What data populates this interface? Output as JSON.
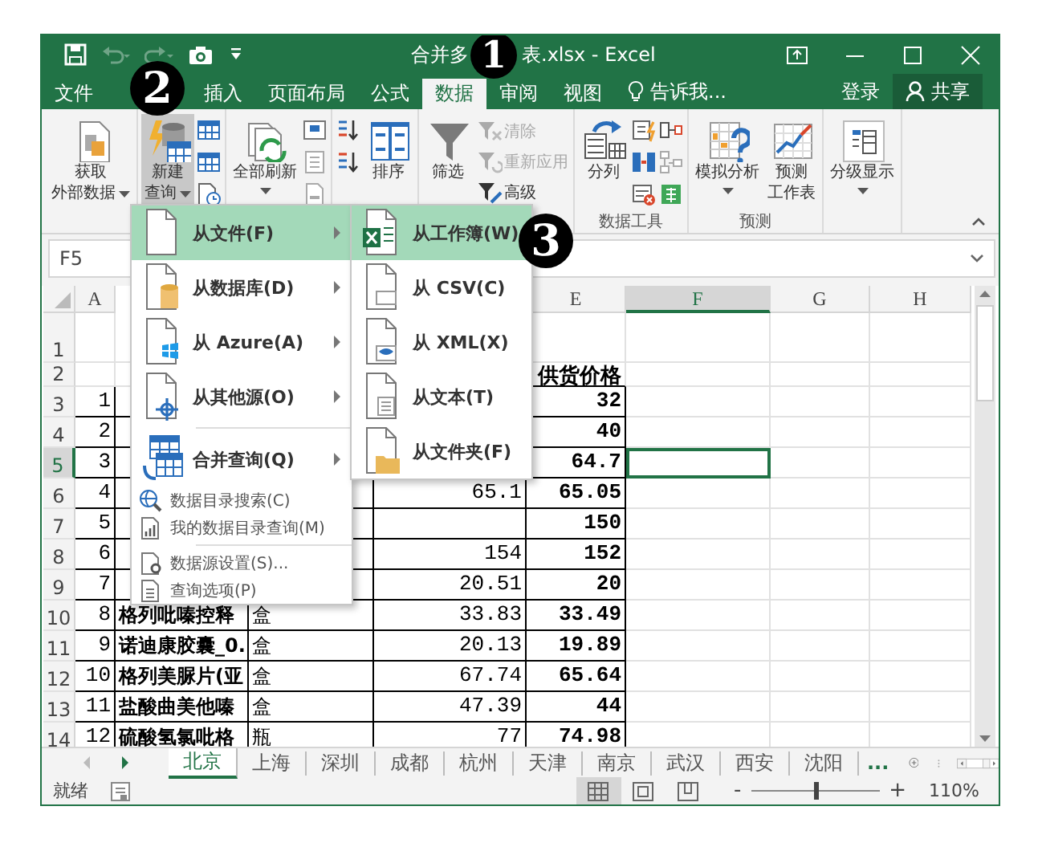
{
  "window": {
    "title_left": "合并多",
    "title_right": "表.xlsx - Excel"
  },
  "menu_tabs": [
    {
      "label": "文件",
      "selected": false
    },
    {
      "label": "插入",
      "selected": false
    },
    {
      "label": "页面布局",
      "selected": false
    },
    {
      "label": "公式",
      "selected": false
    },
    {
      "label": "数据",
      "selected": true
    },
    {
      "label": "审阅",
      "selected": false
    },
    {
      "label": "视图",
      "selected": false
    }
  ],
  "tell_me": "告诉我...",
  "account": {
    "sign_in": "登录",
    "share": "共享"
  },
  "ribbon": {
    "groups": [
      {
        "items": [
          {
            "kind": "large",
            "lines": [
              "获取",
              "外部数据"
            ],
            "dropdown": true,
            "pressed": false
          }
        ]
      },
      {
        "items": [
          {
            "kind": "large",
            "lines": [
              "新建",
              "查询"
            ],
            "dropdown": true,
            "pressed": true
          },
          {
            "kind": "icon-stack"
          }
        ]
      },
      {
        "items": [
          {
            "kind": "large",
            "lines": [
              "全部刷新"
            ],
            "dropdown": true,
            "pressed": false
          },
          {
            "kind": "icon-stack"
          }
        ]
      },
      {
        "items": [
          {
            "kind": "icon-stack"
          },
          {
            "kind": "large",
            "lines": [
              "排序"
            ],
            "dropdown": false,
            "pressed": false
          }
        ]
      },
      {
        "items": [
          {
            "kind": "large",
            "lines": [
              "筛选"
            ],
            "dropdown": false,
            "pressed": false
          },
          {
            "kind": "small-stack",
            "buttons": [
              {
                "label": "清除",
                "disabled": true
              },
              {
                "label": "重新应用",
                "disabled": true
              },
              {
                "label": "高级",
                "disabled": false
              }
            ]
          }
        ]
      },
      {
        "label": "数据工具",
        "items": [
          {
            "kind": "large",
            "lines": [
              "分列"
            ],
            "dropdown": false,
            "pressed": false
          },
          {
            "kind": "icon-stack"
          },
          {
            "kind": "icon-stack"
          }
        ]
      },
      {
        "label": "预测",
        "items": [
          {
            "kind": "large",
            "lines": [
              "模拟分析"
            ],
            "dropdown": true,
            "pressed": false
          },
          {
            "kind": "large",
            "lines": [
              "预测",
              "工作表"
            ],
            "dropdown": false,
            "pressed": false
          }
        ]
      },
      {
        "items": [
          {
            "kind": "large",
            "lines": [
              "分级显示"
            ],
            "dropdown": true,
            "pressed": false
          }
        ]
      }
    ]
  },
  "formula_bar": {
    "name_box": "F5"
  },
  "sheet": {
    "columns": [
      {
        "label": "A",
        "selected": false
      },
      {
        "kind": "covered"
      },
      {
        "kind": "covered"
      },
      {
        "kind": "covered"
      },
      {
        "label": "E",
        "selected": false
      },
      {
        "label": "F",
        "selected": true
      },
      {
        "label": "G",
        "selected": false
      },
      {
        "label": "H",
        "selected": false
      }
    ],
    "rows": [
      {
        "header": "1",
        "selected": false,
        "boxed": false
      },
      {
        "header": "2",
        "selected": false,
        "boxed": false,
        "cells": {
          "e": "供货价格"
        }
      },
      {
        "header": "3",
        "selected": false,
        "boxed": true,
        "cells": {
          "a": "1",
          "e": "32"
        }
      },
      {
        "header": "4",
        "selected": false,
        "boxed": true,
        "cells": {
          "a": "2",
          "e": "40"
        }
      },
      {
        "header": "5",
        "selected": true,
        "boxed": true,
        "cells": {
          "a": "3",
          "e": "64.7"
        }
      },
      {
        "header": "6",
        "selected": false,
        "boxed": true,
        "cells": {
          "a": "4",
          "d": "65.1",
          "e": "65.05"
        }
      },
      {
        "header": "7",
        "selected": false,
        "boxed": true,
        "cells": {
          "a": "5",
          "e": "150"
        }
      },
      {
        "header": "8",
        "selected": false,
        "boxed": true,
        "cells": {
          "a": "6",
          "d": "154",
          "e": "152"
        }
      },
      {
        "header": "9",
        "selected": false,
        "boxed": true,
        "cells": {
          "a": "7",
          "d": "20.51",
          "e": "20"
        }
      },
      {
        "header": "10",
        "selected": false,
        "boxed": true,
        "cells": {
          "a": "8",
          "b": "格列吡嗪控释",
          "c": "盒",
          "d": "33.83",
          "e": "33.49"
        }
      },
      {
        "header": "11",
        "selected": false,
        "boxed": true,
        "cells": {
          "a": "9",
          "b": "诺迪康胶囊_0.",
          "c": "盒",
          "d": "20.13",
          "e": "19.89"
        }
      },
      {
        "header": "12",
        "selected": false,
        "boxed": true,
        "cells": {
          "a": "10",
          "b": "格列美脲片(亚",
          "c": "盒",
          "d": "67.74",
          "e": "65.64"
        }
      },
      {
        "header": "13",
        "selected": false,
        "boxed": true,
        "cells": {
          "a": "11",
          "b": "盐酸曲美他嗪",
          "c": "盒",
          "d": "47.39",
          "e": "44"
        }
      },
      {
        "header": "14",
        "selected": false,
        "boxed": true,
        "cells": {
          "a": "12",
          "b": "硫酸氢氯吡格",
          "c": "瓶",
          "d": "77",
          "e": "74.98"
        }
      }
    ]
  },
  "sheet_tabs": {
    "tabs": [
      {
        "label": "北京",
        "selected": true
      },
      {
        "label": "上海",
        "selected": false
      },
      {
        "label": "深圳",
        "selected": false
      },
      {
        "label": "成都",
        "selected": false
      },
      {
        "label": "杭州",
        "selected": false
      },
      {
        "label": "天津",
        "selected": false
      },
      {
        "label": "南京",
        "selected": false
      },
      {
        "label": "武汉",
        "selected": false
      },
      {
        "label": "西安",
        "selected": false
      },
      {
        "label": "沈阳",
        "selected": false
      }
    ],
    "more": "..."
  },
  "status_bar": {
    "text": "就绪",
    "views": [
      {
        "selected": true
      },
      {
        "selected": false
      },
      {
        "selected": false
      }
    ],
    "zoom": {
      "minus": "-",
      "plus": "+",
      "level": 0.5,
      "reading": "110%"
    }
  },
  "new_query_menu": {
    "items": [
      {
        "kind": "large",
        "label": "从文件(F)",
        "selected": true,
        "submenu": true
      },
      {
        "kind": "large",
        "label": "从数据库(D)",
        "selected": false,
        "submenu": true
      },
      {
        "kind": "large",
        "label": "从 Azure(A)",
        "selected": false,
        "submenu": true
      },
      {
        "kind": "large",
        "label": "从其他源(O)",
        "selected": false,
        "submenu": true
      },
      {
        "kind": "separator"
      },
      {
        "kind": "large",
        "label": "合并查询(Q)",
        "selected": false,
        "submenu": true
      },
      {
        "kind": "small",
        "label": "数据目录搜索(C)"
      },
      {
        "kind": "small",
        "label": "我的数据目录查询(M)"
      },
      {
        "kind": "separator"
      },
      {
        "kind": "small",
        "label": "数据源设置(S)..."
      },
      {
        "kind": "small",
        "label": "查询选项(P)"
      }
    ]
  },
  "from_file_menu": {
    "items": [
      {
        "label": "从工作簿(W)",
        "selected": true
      },
      {
        "label": "从 CSV(C)",
        "selected": false
      },
      {
        "label": "从 XML(X)",
        "selected": false
      },
      {
        "label": "从文本(T)",
        "selected": false
      },
      {
        "label": "从文件夹(F)",
        "selected": false
      }
    ]
  },
  "callouts": [
    {
      "label": "1"
    },
    {
      "label": "2"
    },
    {
      "label": "3"
    }
  ]
}
